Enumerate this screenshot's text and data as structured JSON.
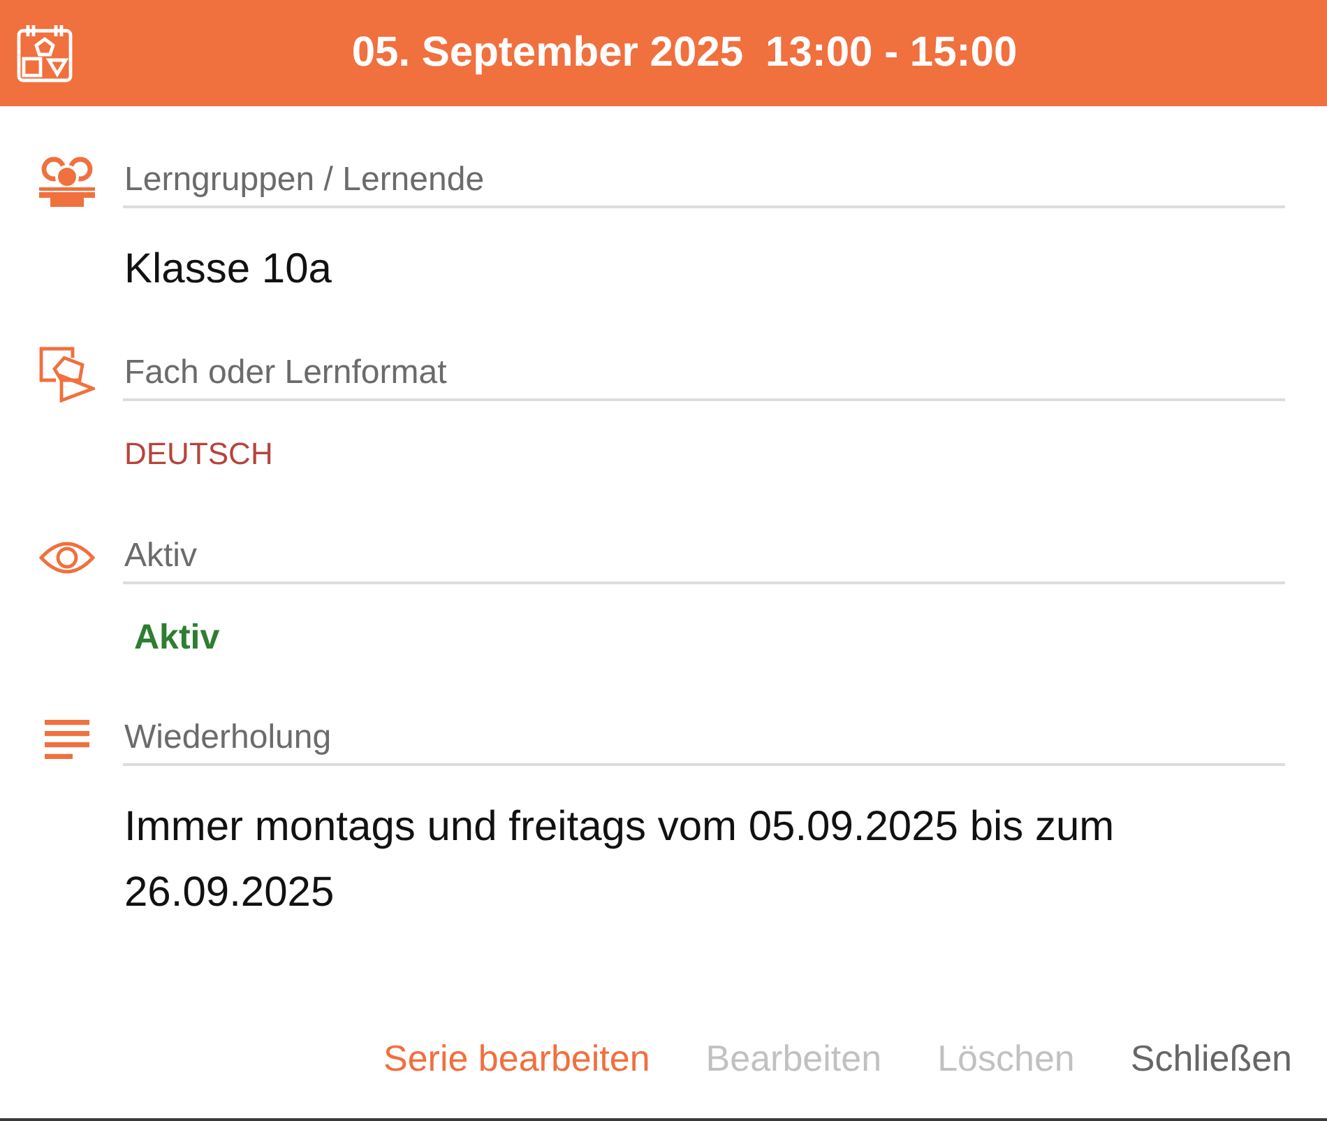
{
  "header": {
    "date": "05. September 2025",
    "time": "13:00 - 15:00"
  },
  "fields": [
    {
      "kind": "text",
      "label": "Lerngruppen / Lernende",
      "value": "Klasse 10a"
    },
    {
      "kind": "subject",
      "label": "Fach oder Lernformat",
      "value": "DEUTSCH"
    },
    {
      "kind": "status",
      "label": "Aktiv",
      "value": "Aktiv"
    },
    {
      "kind": "text",
      "label": "Wiederholung",
      "value": "Immer montags und freitags vom 05.09.2025 bis zum 26.09.2025"
    }
  ],
  "buttons": [
    {
      "kind": "accent",
      "label": "Serie bearbeiten",
      "disabled": false
    },
    {
      "kind": "plain",
      "label": "Bearbeiten",
      "disabled": true
    },
    {
      "kind": "plain",
      "label": "Löschen",
      "disabled": true
    },
    {
      "kind": "plain",
      "label": "Schließen",
      "disabled": false
    }
  ]
}
